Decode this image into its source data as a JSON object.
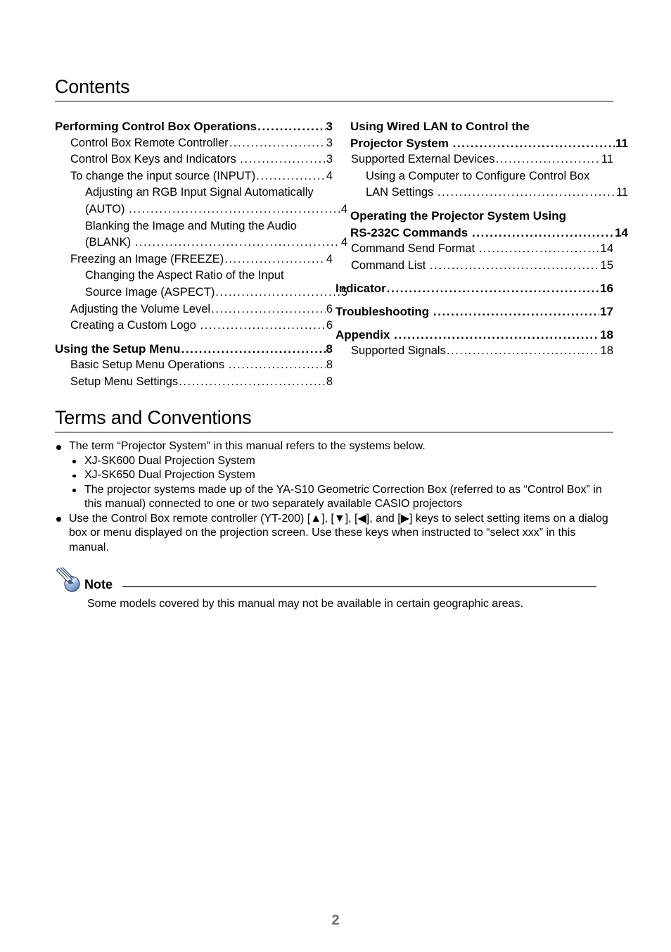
{
  "document": {
    "page_number": "2"
  },
  "contents": {
    "heading": "Contents",
    "left_column": [
      {
        "level": 1,
        "label": "Performing Control Box Operations",
        "page": "3"
      },
      {
        "level": 2,
        "label": "Control Box Remote Controller",
        "page": "3"
      },
      {
        "level": 2,
        "label": "Control Box Keys and Indicators ",
        "page": "3"
      },
      {
        "level": 2,
        "label": "To change the input source (INPUT)",
        "page": "4"
      },
      {
        "level": 2,
        "label": "Adjusting an RGB Input Signal Automatically",
        "label2": "(AUTO) ",
        "page": "4"
      },
      {
        "level": 2,
        "label": "Blanking the Image and Muting the Audio",
        "label2": "(BLANK) ",
        "page": "4"
      },
      {
        "level": 2,
        "label": "Freezing an Image (FREEZE)",
        "page": "4"
      },
      {
        "level": 2,
        "label": "Changing the Aspect Ratio of the Input",
        "label2": "Source Image (ASPECT)",
        "page": "5"
      },
      {
        "level": 2,
        "label": "Adjusting the Volume Level",
        "page": "6"
      },
      {
        "level": 2,
        "label": "Creating a Custom Logo ",
        "page": "6"
      },
      {
        "level": 1,
        "label": "Using the Setup Menu",
        "page": "8"
      },
      {
        "level": 2,
        "label": "Basic Setup Menu Operations ",
        "page": "8"
      },
      {
        "level": 2,
        "label": "Setup Menu Settings",
        "page": "8"
      }
    ],
    "right_column": [
      {
        "level": 1,
        "label": "Using Wired LAN to Control the",
        "label2": "Projector System ",
        "page": "11"
      },
      {
        "level": 2,
        "label": "Supported External Devices",
        "page": "11"
      },
      {
        "level": 2,
        "label": "Using a Computer to Configure Control Box",
        "label2": "LAN Settings ",
        "page": "11"
      },
      {
        "level": 1,
        "label": "Operating the Projector System Using",
        "label2": "RS-232C Commands ",
        "page": "14"
      },
      {
        "level": 2,
        "label": "Command Send Format ",
        "page": "14"
      },
      {
        "level": 2,
        "label": "Command List ",
        "page": "15"
      },
      {
        "level": 1,
        "label": "Indicator",
        "page": "16"
      },
      {
        "level": 1,
        "label": "Troubleshooting ",
        "page": "17"
      },
      {
        "level": 1,
        "label": "Appendix ",
        "page": "18"
      },
      {
        "level": 2,
        "label": "Supported Signals",
        "page": "18"
      }
    ],
    "leader_dots": "...................................................................................................."
  },
  "terms": {
    "heading": "Terms and Conventions",
    "bullet1": "The term “Projector System” in this manual refers to the systems below.",
    "sub1": "XJ-SK600 Dual Projection System",
    "sub2": "XJ-SK650 Dual Projection System",
    "sub3": "The projector systems made up of the YA-S10 Geometric Correction Box (referred to as “Control Box” in this manual) connected to one or two separately available CASIO projectors",
    "bullet2": "Use the Control Box remote controller (YT-200) [▲], [▼], [◀], and [▶] keys to select setting items on a dialog box or menu displayed on the projection screen. Use these keys when instructed to “select xxx” in this manual."
  },
  "note": {
    "icon": "note-pencil-icon",
    "title": "Note",
    "text": "Some models covered by this manual may not be available in certain geographic areas."
  }
}
